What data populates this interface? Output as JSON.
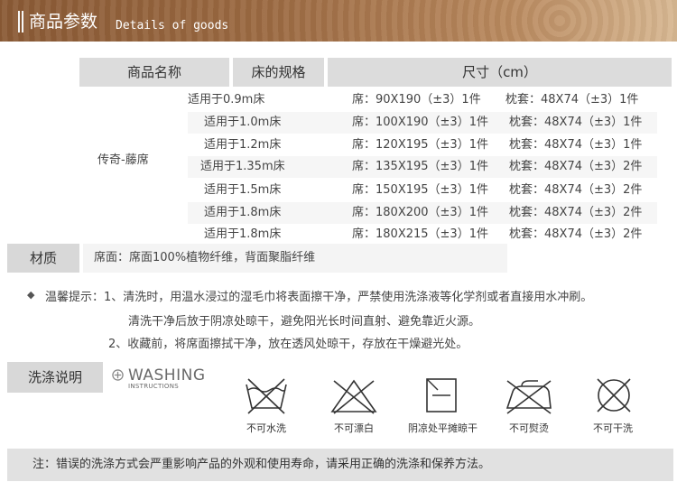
{
  "header": {
    "title": "商品参数",
    "subtitle": "Details of goods"
  },
  "spec_table": {
    "columns": [
      "商品名称",
      "床的规格",
      "尺寸（cm）"
    ],
    "product_name": "传奇-藤席",
    "rows": [
      {
        "bed": "适用于0.9m床",
        "mat": "席：90X190（±3）1件",
        "pillow": "枕套：48X74（±3）1件"
      },
      {
        "bed": "适用于1.0m床",
        "mat": "席：100X190（±3）1件",
        "pillow": "枕套：48X74（±3）1件"
      },
      {
        "bed": "适用于1.2m床",
        "mat": "席：120X195（±3）1件",
        "pillow": "枕套：48X74（±3）1件"
      },
      {
        "bed": "适用于1.35m床",
        "mat": "席：135X195（±3）1件",
        "pillow": "枕套：48X74（±3）2件"
      },
      {
        "bed": "适用于1.5m床",
        "mat": "席：150X195（±3）1件",
        "pillow": "枕套：48X74（±3）2件"
      },
      {
        "bed": "适用于1.8m床",
        "mat": "席：180X200（±3）1件",
        "pillow": "枕套：48X74（±3）2件"
      },
      {
        "bed": "适用于1.8m床",
        "mat": "席：180X215（±3）1件",
        "pillow": "枕套：48X74（±3）2件"
      }
    ]
  },
  "material": {
    "label": "材质",
    "value": "席面：席面100%植物纤维，背面聚脂纤维"
  },
  "tips": {
    "bullet_icon": "diamond-bullet-icon",
    "line1": "温馨提示：1、清洗时，用温水浸过的湿毛巾将表面擦干净，严禁使用洗涤液等化学剂或者直接用水冲刷。",
    "line2": "清洗干净后放于阴凉处晾干，避免阳光长时间直射、避免靠近火源。",
    "line3": "2、收藏前，将席面擦拭干净，放在透风处晾干，存放在干燥避光处。"
  },
  "washing": {
    "label": "洗涤说明",
    "title": "WASHING",
    "subtitle": "INSTRUCTIONS",
    "symbols": [
      {
        "icon": "no-wash-icon",
        "label": "不可水洗"
      },
      {
        "icon": "no-bleach-icon",
        "label": "不可漂白"
      },
      {
        "icon": "dry-flat-in-shade-icon",
        "label": "阴凉处平摊晾干"
      },
      {
        "icon": "no-iron-icon",
        "label": "不可熨烫"
      },
      {
        "icon": "no-dry-clean-icon",
        "label": "不可干洗"
      }
    ]
  },
  "note": "注：错误的洗涤方式会严重影响产品的外观和使用寿命，请采用正确的洗涤和保养方法。",
  "colors": {
    "banner_dark": "#8a5a35",
    "banner_light": "#d8b892",
    "header_gray": "#dcdcdc",
    "note_gray": "#e1e1e1"
  }
}
